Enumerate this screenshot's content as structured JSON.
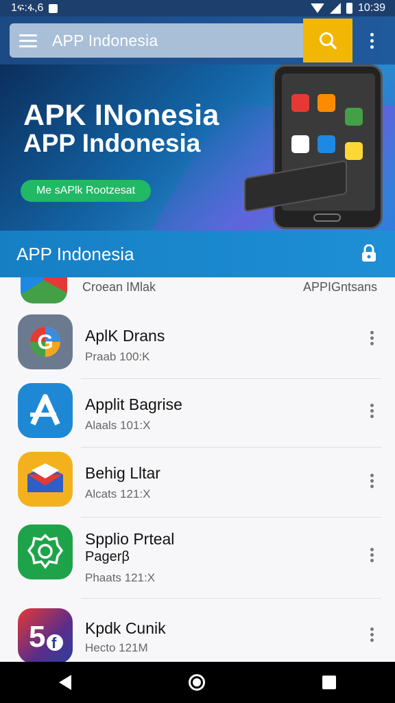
{
  "status_bar": {
    "left_text": "1ፍ:ፋ,6",
    "time": "10:39"
  },
  "app_bar": {
    "title": "APP Indonesia"
  },
  "banner": {
    "line1": "APK INonesia",
    "line2": "APP Indonesia",
    "cta_label": "Me sAPlk Rootzesat"
  },
  "section": {
    "title": "APP Indonesia"
  },
  "partial_row": {
    "name": "Croean IMlak",
    "meta": "APPIGntsans"
  },
  "apps": [
    {
      "name": "AplK Drans",
      "meta": "Praab 100:K",
      "icon": "g-paint-icon",
      "color": "#6b7a8e"
    },
    {
      "name": "Applit Bagrise",
      "meta": "Alaals 101:X",
      "icon": "a-letter-icon",
      "color": "#1e88d5"
    },
    {
      "name": "Behig Lltar",
      "meta": "Alcats 121:X",
      "icon": "envelope-icon",
      "color": "#f3b21d"
    },
    {
      "name": "Spplio Prteal",
      "name_line2": "Pagerβ",
      "meta": "Phaats 121:X",
      "icon": "badge-icon",
      "color": "#1fa34a"
    },
    {
      "name": "Kpdk Cunik",
      "meta": "Hecto 121M",
      "icon": "five-f-icon",
      "color": "#5a2d8a"
    }
  ],
  "nav": {
    "back": "back-icon",
    "home": "home-icon",
    "recent": "recent-apps-icon"
  }
}
